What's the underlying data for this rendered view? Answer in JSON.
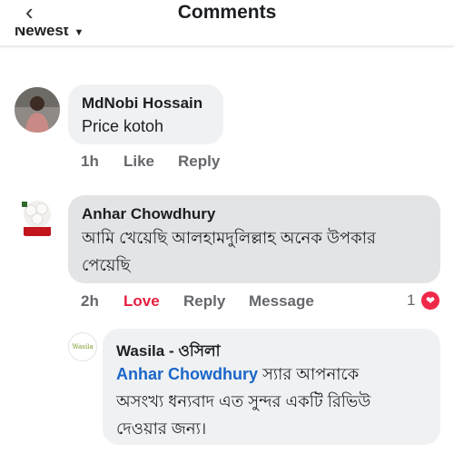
{
  "header": {
    "back_icon": "chevron-left-icon",
    "title": "Comments"
  },
  "sort": {
    "label": "Newest",
    "caret_icon": "caret-down-icon"
  },
  "comments": [
    {
      "author": "MdNobi Hossain",
      "text": "Price kotoh",
      "time": "1h",
      "like": "Like",
      "reply": "Reply"
    },
    {
      "author": "Anhar Chowdhury",
      "text_line1": "আমি খেয়েছি আলহামদুলিল্লাহ অনেক উপকার",
      "text_line2": "পেয়েছি",
      "time": "2h",
      "reaction": "Love",
      "reply": "Reply",
      "message": "Message",
      "reaction_count": "1",
      "reaction_icon": "heart-icon"
    }
  ],
  "reply": {
    "avatar_text": "Wasila",
    "author": "Wasila - ওসিলা",
    "mention": "Anhar Chowdhury",
    "text_line1_rest": " স্যার আপনাকে",
    "text_line2": "অসংখ্য ধন্যবাদ এত সুন্দর একটি রিভিউ",
    "text_line3": "দেওয়ার জন্য।"
  },
  "colors": {
    "love": "#e41e3f",
    "mention": "#1a66c9",
    "bubble": "#eff1f3"
  }
}
